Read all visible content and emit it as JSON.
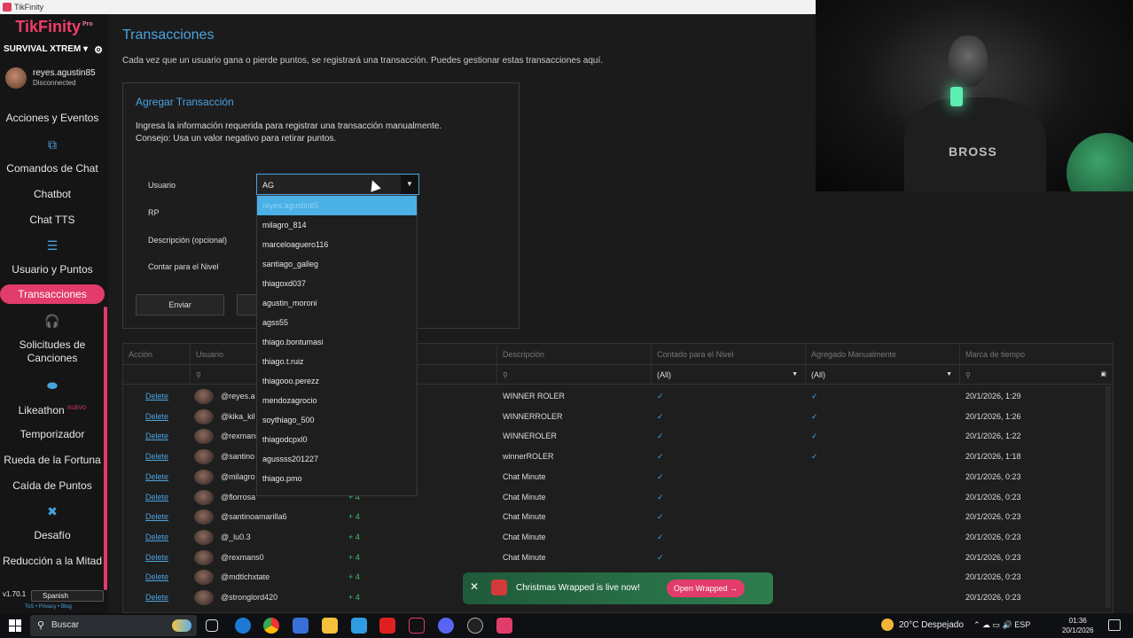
{
  "window": {
    "title": "TikFinity"
  },
  "sidebar": {
    "logo": "TikFinity",
    "logo_badge": "Pro",
    "account": "SURVIVAL XTREM",
    "user": {
      "name": "reyes.agustin85",
      "status": "Disconnected"
    },
    "items": [
      {
        "label": "Acciones y Eventos"
      },
      {
        "label": "Comandos de Chat"
      },
      {
        "label": "Chatbot"
      },
      {
        "label": "Chat TTS"
      },
      {
        "label": "Usuario y Puntos"
      },
      {
        "label": "Transacciones"
      },
      {
        "label": "Solicitudes de Canciones"
      },
      {
        "label": "Likeathon",
        "badge": "NUEVO"
      },
      {
        "label": "Temporizador"
      },
      {
        "label": "Rueda de la Fortuna"
      },
      {
        "label": "Caída de Puntos"
      },
      {
        "label": "Desafío"
      },
      {
        "label": "Reducción a la Mitad"
      }
    ],
    "icons": [
      "chat-bubbles-icon",
      "list-icon",
      "headphones-icon",
      "gamepad-icon",
      "crossed-tools-icon"
    ],
    "version": "v1.70.1",
    "language": "Spanish",
    "links": "ToS • Privacy • Blog"
  },
  "page": {
    "title": "Transacciones",
    "description": "Cada vez que un usuario gana o pierde puntos, se registrará una transacción. Puedes gestionar estas transacciones aquí."
  },
  "form": {
    "title": "Agregar Transacción",
    "info_line1": "Ingresa la información requerida para registrar una transacción manualmente.",
    "info_line2": "Consejo: Usa un valor negativo para retirar puntos.",
    "label_user": "Usuario",
    "label_rp": "RP",
    "label_desc": "Descripción (opcional)",
    "label_level": "Contar para el Nivel",
    "user_value": "AG",
    "submit": "Enviar"
  },
  "dropdown_options": [
    "reyes.agustin85",
    "milagro_814",
    "marceloaguero116",
    "santiago_galleg",
    "thiagoxd037",
    "agustin_moroni",
    "agss55",
    "thiago.bontumasi",
    "thiago.t.ruiz",
    "thiagooo.perezz",
    "mendozagrocio",
    "soythiago_500",
    "thiagodcpxl0",
    "agussss201227",
    "thiago.pmo"
  ],
  "grid": {
    "headers": [
      "Acción",
      "Usuario",
      "",
      "Descripción",
      "Contado para el Nivel",
      "Agregado Manualmente",
      "Marca de tiempo"
    ],
    "filter_all": "(All)",
    "action_label": "Delete",
    "rows": [
      {
        "user": "@reyes.a",
        "points": "",
        "desc": "WINNER ROLER",
        "level": "✓",
        "manual": "✓",
        "time": "20/1/2026, 1:29"
      },
      {
        "user": "@kika_kil",
        "points": "",
        "desc": "WINNERROLER",
        "level": "✓",
        "manual": "✓",
        "time": "20/1/2026, 1:26"
      },
      {
        "user": "@rexmans",
        "points": "",
        "desc": "WINNEROLER",
        "level": "✓",
        "manual": "✓",
        "time": "20/1/2026, 1:22"
      },
      {
        "user": "@santino",
        "points": "",
        "desc": "winnerROLER",
        "level": "✓",
        "manual": "✓",
        "time": "20/1/2026, 1:18"
      },
      {
        "user": "@milagro",
        "points": "",
        "desc": "Chat Minute",
        "level": "✓",
        "manual": "",
        "time": "20/1/2026, 0:23"
      },
      {
        "user": "@florrosa",
        "points": "+ 4",
        "desc": "Chat Minute",
        "level": "✓",
        "manual": "",
        "time": "20/1/2026, 0:23"
      },
      {
        "user": "@santinoamarilla6",
        "points": "+ 4",
        "desc": "Chat Minute",
        "level": "✓",
        "manual": "",
        "time": "20/1/2026, 0:23"
      },
      {
        "user": "@_lu0.3",
        "points": "+ 4",
        "desc": "Chat Minute",
        "level": "✓",
        "manual": "",
        "time": "20/1/2026, 0:23"
      },
      {
        "user": "@rexmans0",
        "points": "+ 4",
        "desc": "Chat Minute",
        "level": "✓",
        "manual": "",
        "time": "20/1/2026, 0:23"
      },
      {
        "user": "@mdtlchxtate",
        "points": "+ 4",
        "desc": "",
        "level": "✓",
        "manual": "",
        "time": "20/1/2026, 0:23"
      },
      {
        "user": "@stronglord420",
        "points": "+ 4",
        "desc": "",
        "level": "✓",
        "manual": "",
        "time": "20/1/2026, 0:23"
      }
    ]
  },
  "webcam": {
    "shirt_text": "BROSS"
  },
  "toast": {
    "text": "Christmas Wrapped is live now!",
    "button": "Open Wrapped →",
    "close": "✕"
  },
  "taskbar": {
    "search": "Buscar",
    "weather": "20°C  Despejado",
    "lang": "ESP",
    "time": "01:36",
    "date": "20/1/2026"
  },
  "colors": {
    "accent": "#e23c6a",
    "link": "#4aa3e0",
    "selected_option": "#4ab0e6"
  }
}
